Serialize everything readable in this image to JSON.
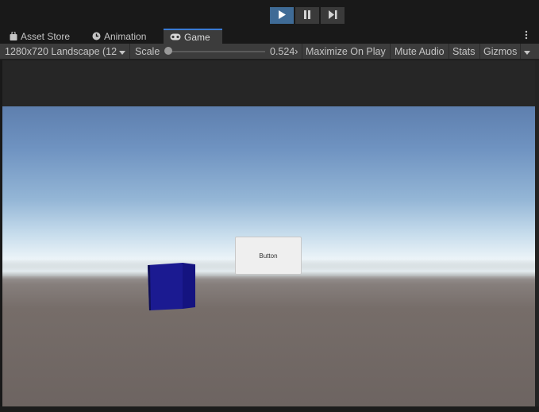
{
  "play_toolbar": {
    "play_icon": "play-icon",
    "pause_icon": "pause-icon",
    "step_icon": "step-icon",
    "play_active": true
  },
  "tabs": [
    {
      "label": "Asset Store",
      "icon": "bag-icon"
    },
    {
      "label": "Animation",
      "icon": "clock-icon"
    },
    {
      "label": "Game",
      "icon": "gamepad-icon",
      "active": true
    }
  ],
  "tab_menu_icon": "more-vert-icon",
  "game_toolbar": {
    "resolution": "1280x720 Landscape (12",
    "scale_label": "Scale",
    "scale_value": "0.524",
    "scale_suffix": "›",
    "maximize_on_play": "Maximize On Play",
    "mute_audio": "Mute Audio",
    "stats": "Stats",
    "gizmos": "Gizmos"
  },
  "game_view": {
    "button_label": "Button",
    "cube_color": "#1b1a91"
  },
  "colors": {
    "accent": "#3f6b96",
    "active_tab_line": "#3a7bd5"
  }
}
